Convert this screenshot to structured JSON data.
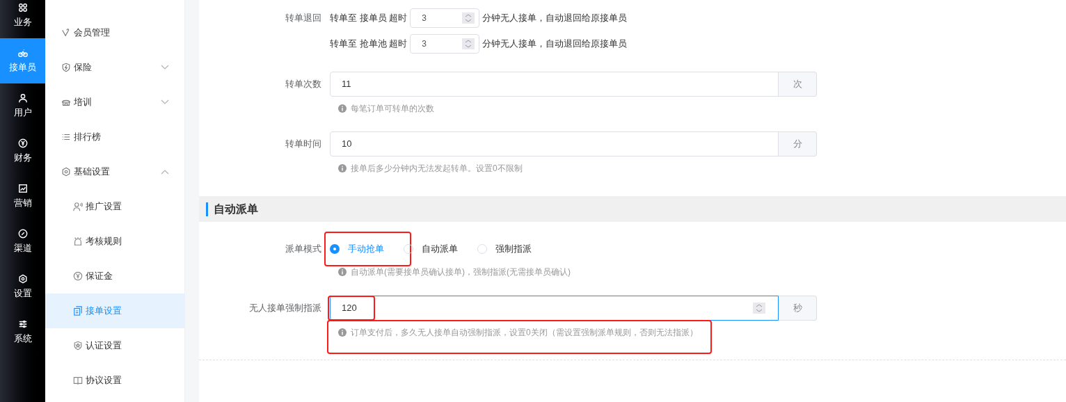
{
  "rail": [
    {
      "label": "业务",
      "selected": false
    },
    {
      "label": "接单员",
      "selected": true
    },
    {
      "label": "用户",
      "selected": false
    },
    {
      "label": "财务",
      "selected": false
    },
    {
      "label": "营销",
      "selected": false
    },
    {
      "label": "渠道",
      "selected": false
    },
    {
      "label": "设置",
      "selected": false
    },
    {
      "label": "系统",
      "selected": false
    }
  ],
  "menu": [
    {
      "label": "会员管理",
      "selected": false
    },
    {
      "label": "保险",
      "selected": false,
      "expanded": false
    },
    {
      "label": "培训",
      "selected": false,
      "expanded": false
    },
    {
      "label": "排行榜",
      "selected": false
    },
    {
      "label": "基础设置",
      "selected": false,
      "expanded": true,
      "children": [
        {
          "label": "推广设置",
          "selected": false
        },
        {
          "label": "考核规则",
          "selected": false
        },
        {
          "label": "保证金",
          "selected": false
        },
        {
          "label": "接单设置",
          "selected": true
        },
        {
          "label": "认证设置",
          "selected": false
        },
        {
          "label": "协议设置",
          "selected": false
        }
      ]
    }
  ],
  "transfer_return": {
    "label": "转单退回",
    "rows": [
      {
        "prefix": "转单至 接单员 超时",
        "value": "3",
        "suffix": "分钟无人接单，自动退回给原接单员"
      },
      {
        "prefix": "转单至 抢单池 超时",
        "value": "3",
        "suffix": "分钟无人接单，自动退回给原接单员"
      }
    ]
  },
  "fields": [
    {
      "label": "转单次数",
      "value": "11",
      "unit": "次",
      "hint": "每笔订单可转单的次数"
    },
    {
      "label": "转单时间",
      "value": "10",
      "unit": "分",
      "hint": "接单后多少分钟内无法发起转单。设置0不限制"
    }
  ],
  "section": {
    "title": "自动派单"
  },
  "dispatch_mode": {
    "label": "派单模式",
    "options": [
      {
        "label": "手动抢单",
        "selected": true
      },
      {
        "label": "自动派单",
        "selected": false
      },
      {
        "label": "强制指派",
        "selected": false
      }
    ],
    "hint": "自动派单(需要接单员确认接单)，强制指派(无需接单员确认)"
  },
  "force_assign": {
    "label": "无人接单强制指派",
    "value": "120",
    "unit": "秒",
    "focused": true,
    "hint": "订单支付后，多久无人接单自动强制指派，设置0关闭（需设置强制派单规则，否则无法指派）"
  }
}
